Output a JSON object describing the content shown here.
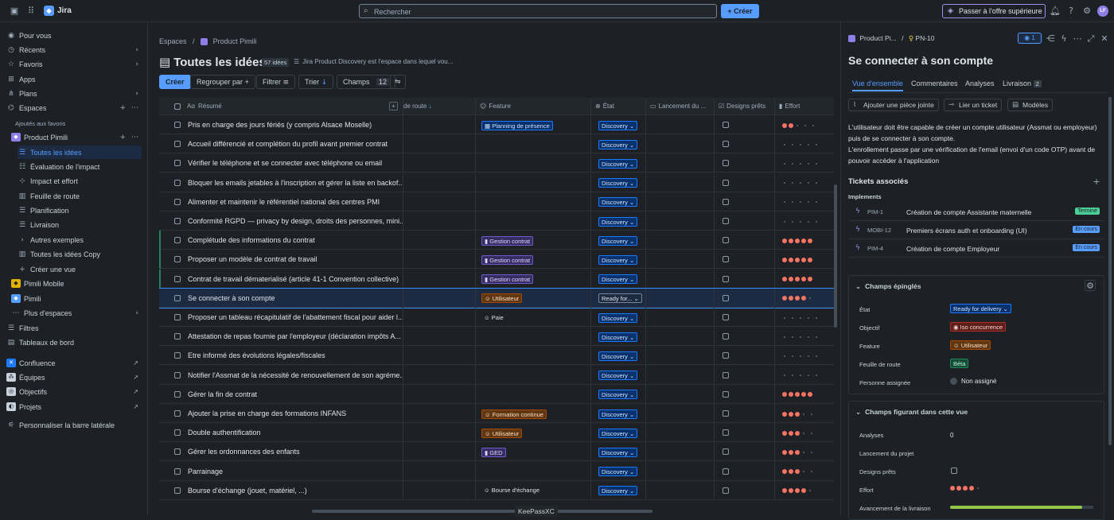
{
  "topbar": {
    "app_name": "Jira",
    "search_placeholder": "Rechercher",
    "create_label": "+ Créer",
    "upgrade_label": "Passer à l'offre supérieure",
    "avatar_initials": "LF"
  },
  "sidebar": {
    "items": [
      {
        "label": "Pour vous",
        "icon": "user-icon"
      },
      {
        "label": "Récents",
        "icon": "clock-icon"
      },
      {
        "label": "Favoris",
        "icon": "star-icon"
      },
      {
        "label": "Apps",
        "icon": "apps-icon"
      },
      {
        "label": "Plans",
        "icon": "plans-icon"
      },
      {
        "label": "Espaces",
        "icon": "spaces-icon"
      }
    ],
    "section_label": "Ajoutés aux favoris",
    "project": "Product Pimili",
    "sub_items": [
      "Toutes les idées",
      "Évaluation de l'impact",
      "Impact et effort",
      "Feuille de route",
      "Planification",
      "Livraison",
      "Autres exemples",
      "Toutes les idées Copy",
      "Créer une vue"
    ],
    "projects": [
      "Pimili Mobile",
      "Pimili"
    ],
    "more_spaces": "Plus d'espaces",
    "filters": "Filtres",
    "dashboards": "Tableaux de bord",
    "apps": [
      "Confluence",
      "Équipes",
      "Objectifs",
      "Projets"
    ],
    "customize": "Personnaliser la barre latérale"
  },
  "main": {
    "breadcrumb_root": "Espaces",
    "breadcrumb_project": "Product Pimili",
    "title": "Toutes les idées",
    "count": "57 idées",
    "description": "Jira Product Discovery est l'espace dans lequel vou...",
    "toolbar": {
      "create": "Créer",
      "group": "Regrouper par",
      "filter": "Filtrer",
      "sort": "Trier",
      "fields": "Champs",
      "fields_count": "12"
    },
    "columns": [
      "Résumé",
      "de route",
      "Feature",
      "État",
      "Lancement du ...",
      "Designs prêts",
      "Effort"
    ],
    "rows": [
      {
        "title": "Pris en charge des jours fériés (y compris Alsace Moselle)",
        "feature": "Planning de présence",
        "fclass": "blue",
        "state": "Discovery",
        "effort": 2
      },
      {
        "title": "Accueil différencié et complétion du profil avant premier contrat",
        "feature": "",
        "state": "Discovery",
        "effort": 0
      },
      {
        "title": "Vérifier le téléphone et se connecter avec téléphone ou email",
        "feature": "",
        "state": "Discovery",
        "effort": 0
      },
      {
        "title": "Bloquer les emails jetables à l'inscription et gérer la liste en backof...",
        "feature": "",
        "state": "Discovery",
        "effort": 0
      },
      {
        "title": "Alimenter et maintenir le référentiel national des centres PMI",
        "feature": "",
        "state": "Discovery",
        "effort": 0
      },
      {
        "title": "Conformité RGPD — privacy by design, droits des personnes, mini...",
        "feature": "",
        "state": "Discovery",
        "effort": 0
      },
      {
        "title": "Complétude des informations du contrat",
        "feature": "Gestion contrat",
        "fclass": "purple",
        "state": "Discovery",
        "effort": 5
      },
      {
        "title": "Proposer un modèle de contrat de travail",
        "feature": "Gestion contrat",
        "fclass": "purple",
        "state": "Discovery",
        "effort": 5
      },
      {
        "title": "Contrat de travail dématerialisé (article 41-1 Convention collective)",
        "feature": "Gestion contrat",
        "fclass": "purple",
        "state": "Discovery",
        "effort": 5
      },
      {
        "title": "Se connecter à son compte",
        "feature": "Utilisateur",
        "fclass": "orange",
        "state": "Ready for...",
        "effort": 4,
        "selected": true
      },
      {
        "title": "Proposer un tableau récapitulatif de l'abattement fiscal pour aider l...",
        "feature": "Paie",
        "fclass": "plain",
        "state": "Discovery",
        "effort": 0
      },
      {
        "title": "Attestation de repas fournie par l'employeur (déclaration impôts A...",
        "feature": "",
        "state": "Discovery",
        "effort": 0
      },
      {
        "title": "Etre informé des évolutions légales/fiscales",
        "feature": "",
        "state": "Discovery",
        "effort": 0
      },
      {
        "title": "Notifier l'Assmat de la nécessité de renouvellement de son agréme...",
        "feature": "",
        "state": "Discovery",
        "effort": 0
      },
      {
        "title": "Gérer la fin de contrat",
        "feature": "",
        "state": "Discovery",
        "effort": 5
      },
      {
        "title": "Ajouter la prise en charge des formations INFANS",
        "feature": "Formation continue",
        "fclass": "orange",
        "state": "Discovery",
        "effort": 3
      },
      {
        "title": "Double authentification",
        "feature": "Utilisateur",
        "fclass": "orange",
        "state": "Discovery",
        "effort": 3
      },
      {
        "title": "Gérer les ordonnances des enfants",
        "feature": "GED",
        "fclass": "purple",
        "state": "Discovery",
        "effort": 3
      },
      {
        "title": "Parrainage",
        "feature": "",
        "state": "Discovery",
        "effort": 3
      },
      {
        "title": "Bourse d'échange (jouet, matériel, ...)",
        "feature": "Bourse d'échange",
        "fclass": "plain",
        "state": "Discovery",
        "effort": 4
      }
    ]
  },
  "overlay_label": "KeePassXC",
  "panel": {
    "breadcrumb_project": "Product Pi...",
    "issue_key": "PN-10",
    "watch_count": "1",
    "title": "Se connecter à son compte",
    "tabs": [
      "Vue d'ensemble",
      "Commentaires",
      "Analyses",
      "Livraison"
    ],
    "delivery_count": "2",
    "actions": [
      "Ajouter une pièce jointe",
      "Lier un ticket",
      "Modèles"
    ],
    "description_1": "L'utilisateur doit être capable de créer un compte utilisateur (Assmat ou employeur) puis de se connecter à son compte.",
    "description_2": "L'enrollement passe par une vérification de l'email (envoi d'un code OTP) avant de pouvoir accéder à l'application",
    "linked_title": "Tickets associés",
    "implements": "Implements",
    "tickets": [
      {
        "key": "PIM-1",
        "name": "Création de compte Assistante maternelle",
        "status": "Terminé",
        "scolor": "#4bce97"
      },
      {
        "key": "MOBI-12",
        "name": "Premiers écrans auth et onboarding (UI)",
        "status": "En cours",
        "scolor": "#579dff"
      },
      {
        "key": "PIM-4",
        "name": "Création de compte Employeur",
        "status": "En cours",
        "scolor": "#579dff"
      }
    ],
    "pinned_title": "Champs épinglés",
    "pinned": {
      "state_label": "État",
      "state_value": "Ready for delivery",
      "goal_label": "Objectif",
      "goal_value": "Iso concurrence",
      "feature_label": "Feature",
      "feature_value": "Utilisateur",
      "roadmap_label": "Feuille de route",
      "roadmap_value": "Béta",
      "assignee_label": "Personne assignée",
      "assignee_value": "Non assigné"
    },
    "view_fields_title": "Champs figurant dans cette vue",
    "view_fields": {
      "analyses_label": "Analyses",
      "analyses_value": "0",
      "launch_label": "Lancement du projet",
      "designs_label": "Designs prêts",
      "effort_label": "Effort",
      "effort_value": 4,
      "progress_label": "Avancement de la livraison",
      "progress_value": 0.92
    }
  }
}
